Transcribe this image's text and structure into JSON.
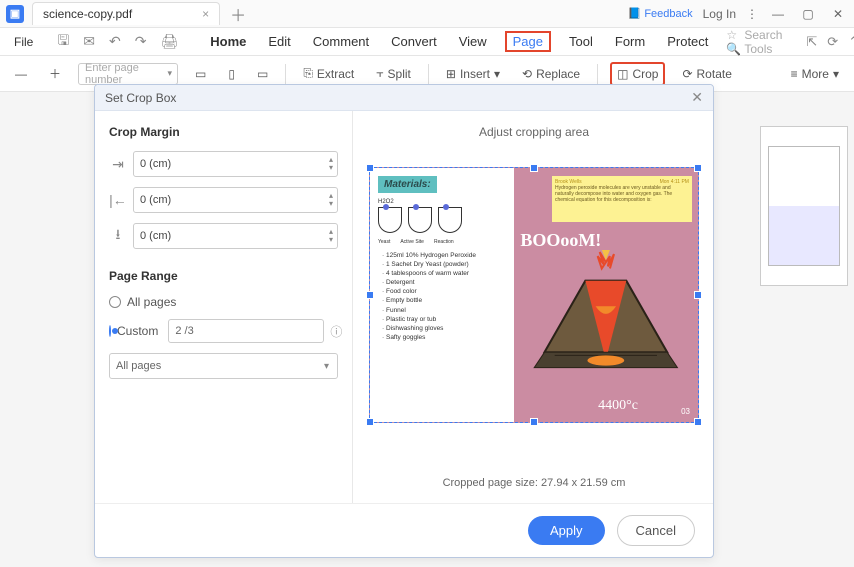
{
  "titlebar": {
    "tab_name": "science-copy.pdf",
    "feedback": "Feedback",
    "login": "Log In"
  },
  "menubar": {
    "file": "File",
    "items": [
      "Home",
      "Edit",
      "Comment",
      "Convert",
      "View",
      "Page",
      "Tool",
      "Form",
      "Protect"
    ],
    "search_placeholder": "Search Tools"
  },
  "toolbar": {
    "page_input_placeholder": "Enter page number",
    "extract": "Extract",
    "split": "Split",
    "insert": "Insert",
    "replace": "Replace",
    "crop": "Crop",
    "rotate": "Rotate",
    "more": "More"
  },
  "modal": {
    "title": "Set Crop Box",
    "crop_margin": "Crop Margin",
    "margin_vals": [
      "0 (cm)",
      "0 (cm)",
      "0 (cm)"
    ],
    "page_range": "Page Range",
    "all_pages": "All pages",
    "custom": "Custom",
    "custom_value": "2 /3",
    "select_value": "All pages",
    "adjust_label": "Adjust cropping area",
    "crop_size": "Cropped page size: 27.94 x 21.59 cm",
    "apply": "Apply",
    "cancel": "Cancel"
  },
  "preview": {
    "materials": "Materials:",
    "h2o2": "H2O2",
    "flask_labels": [
      "Yeast",
      "Active Site",
      "Reaction"
    ],
    "bullets": [
      "125ml 10% Hydrogen Peroxide",
      "1 Sachet Dry Yeast (powder)",
      "4 tablespoons of warm water",
      "Detergent",
      "Food color",
      "Empty bottle",
      "Funnel",
      "Plastic tray or tub",
      "Dishwashing gloves",
      "Safty goggles"
    ],
    "sticky_author": "Brook Wells",
    "sticky_time": "Mon 4:11 PM",
    "sticky_body": "Hydrogen peroxide molecules are very unstable and naturally decompose into water and oxygen gas. The chemical equation for this decomposition is:",
    "boo": "BOOooM!",
    "deg": "4400°c",
    "pagenum": "03"
  }
}
